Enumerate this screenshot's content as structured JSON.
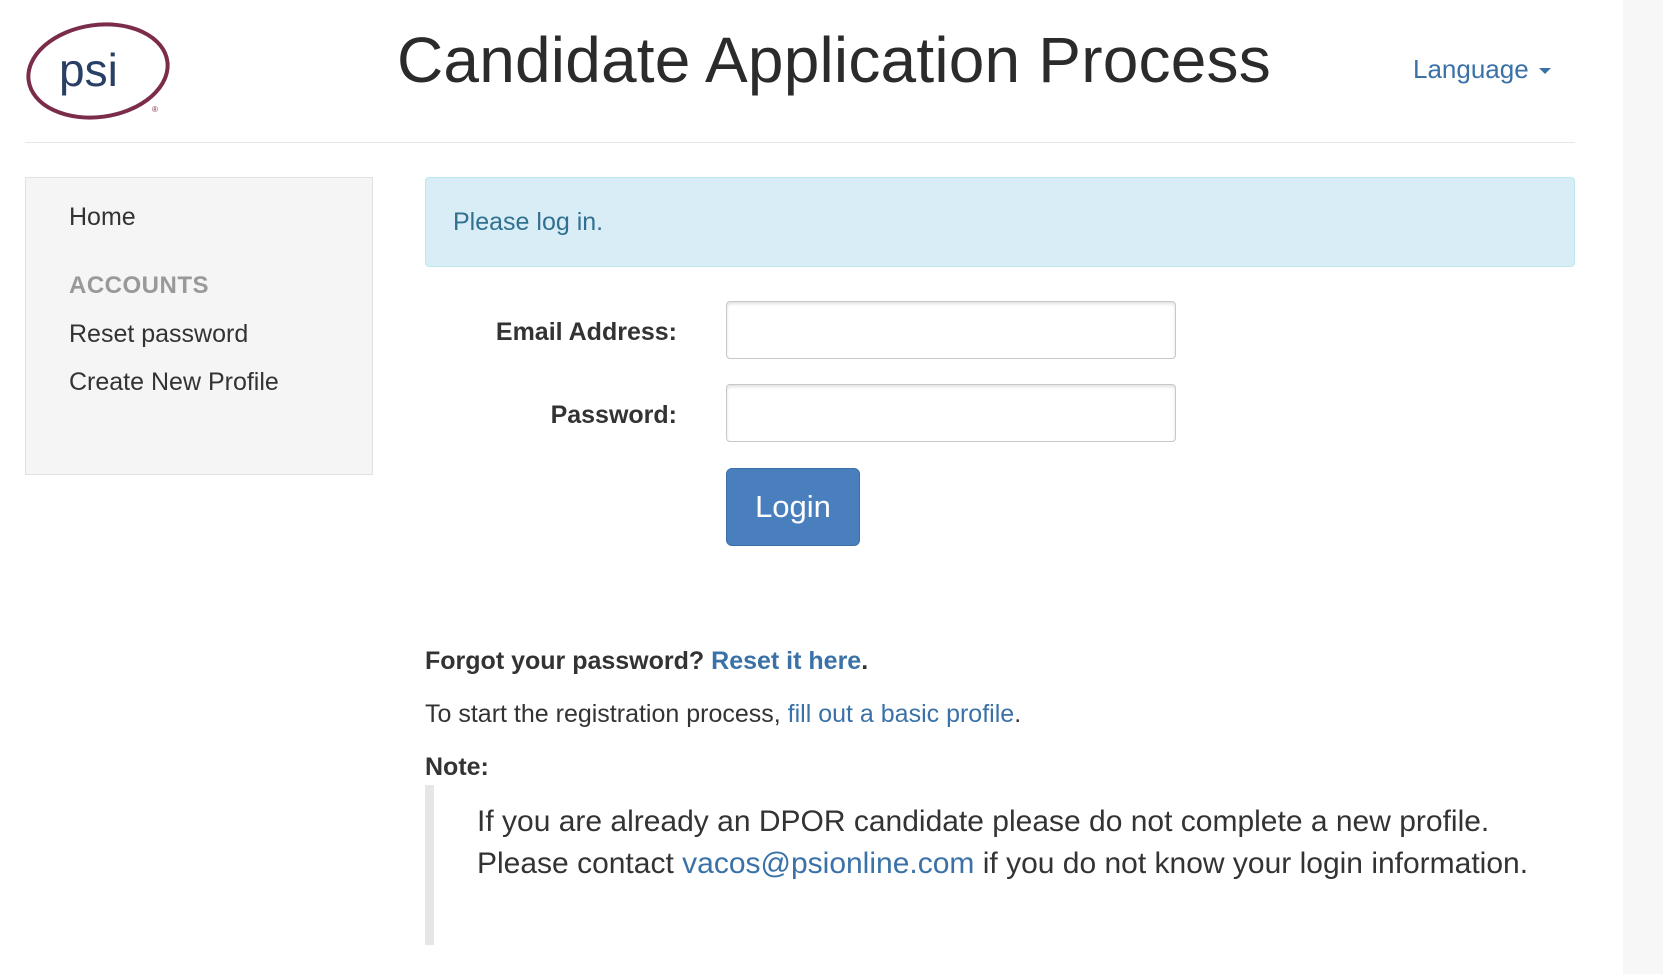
{
  "header": {
    "logo_text": "psi",
    "title": "Candidate Application Process",
    "language_label": "Language"
  },
  "sidebar": {
    "home": "Home",
    "accounts_header": "ACCOUNTS",
    "items": [
      {
        "label": "Reset password"
      },
      {
        "label": "Create New Profile"
      }
    ]
  },
  "alert": {
    "text": "Please log in."
  },
  "form": {
    "email_label": "Email Address:",
    "email_value": "",
    "password_label": "Password:",
    "password_value": "",
    "login_label": "Login"
  },
  "forgot": {
    "prefix": "Forgot your password?",
    "link": "Reset it here",
    "suffix": "."
  },
  "register": {
    "prefix": "To start the registration process,",
    "link": "fill out a basic profile",
    "suffix": "."
  },
  "note": {
    "label": "Note:",
    "line1": "If you are already an DPOR candidate please do not complete a new profile. Please contact",
    "email": "vacos@psionline.com",
    "line2": "if you do not know your login information."
  },
  "colors": {
    "brand_maroon": "#7b2c4a",
    "brand_navy": "#2a3f66",
    "link": "#3a72a8",
    "alert_bg": "#d9edf7",
    "button_bg": "#4a7fbd"
  }
}
